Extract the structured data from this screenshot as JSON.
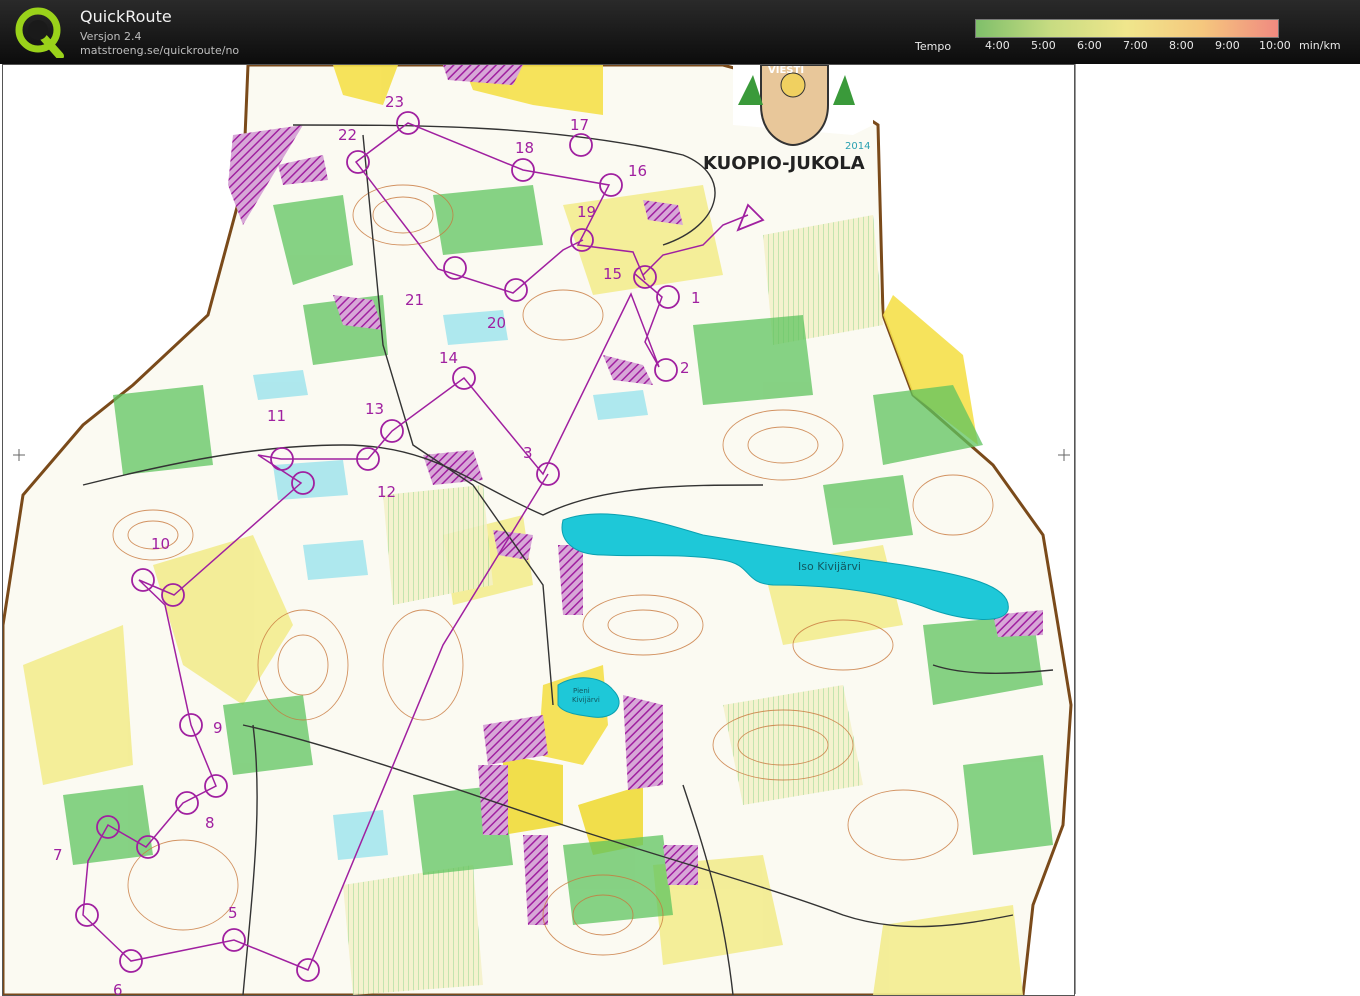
{
  "app": {
    "title": "QuickRoute",
    "version": "Versjon 2.4",
    "url": "matstroeng.se/quickroute/no"
  },
  "tempo": {
    "label": "Tempo",
    "ticks": [
      "4:00",
      "5:00",
      "6:00",
      "7:00",
      "8:00",
      "9:00",
      "10:00"
    ],
    "unit": "min/km",
    "gradient_colors": [
      "#7fbf6a",
      "#c8dc82",
      "#f0e68c",
      "#f5c77e",
      "#f08a80"
    ]
  },
  "map": {
    "logo_text": "KUOPIO-JUKOLA",
    "logo_year": "2014",
    "logo_banner": "VIESTI",
    "lake_label": "Iso Kivijärvi",
    "small_lake_label_1": "Pieni",
    "small_lake_label_2": "Kivijärvi",
    "controls": [
      "1",
      "2",
      "3",
      "5",
      "6",
      "7",
      "8",
      "9",
      "10",
      "11",
      "12",
      "13",
      "14",
      "15",
      "16",
      "17",
      "18",
      "19",
      "20",
      "21",
      "22",
      "23"
    ],
    "course_color": "#a020a0",
    "water_color": "#1ec8d8",
    "forest_color": "#5fc45f"
  }
}
